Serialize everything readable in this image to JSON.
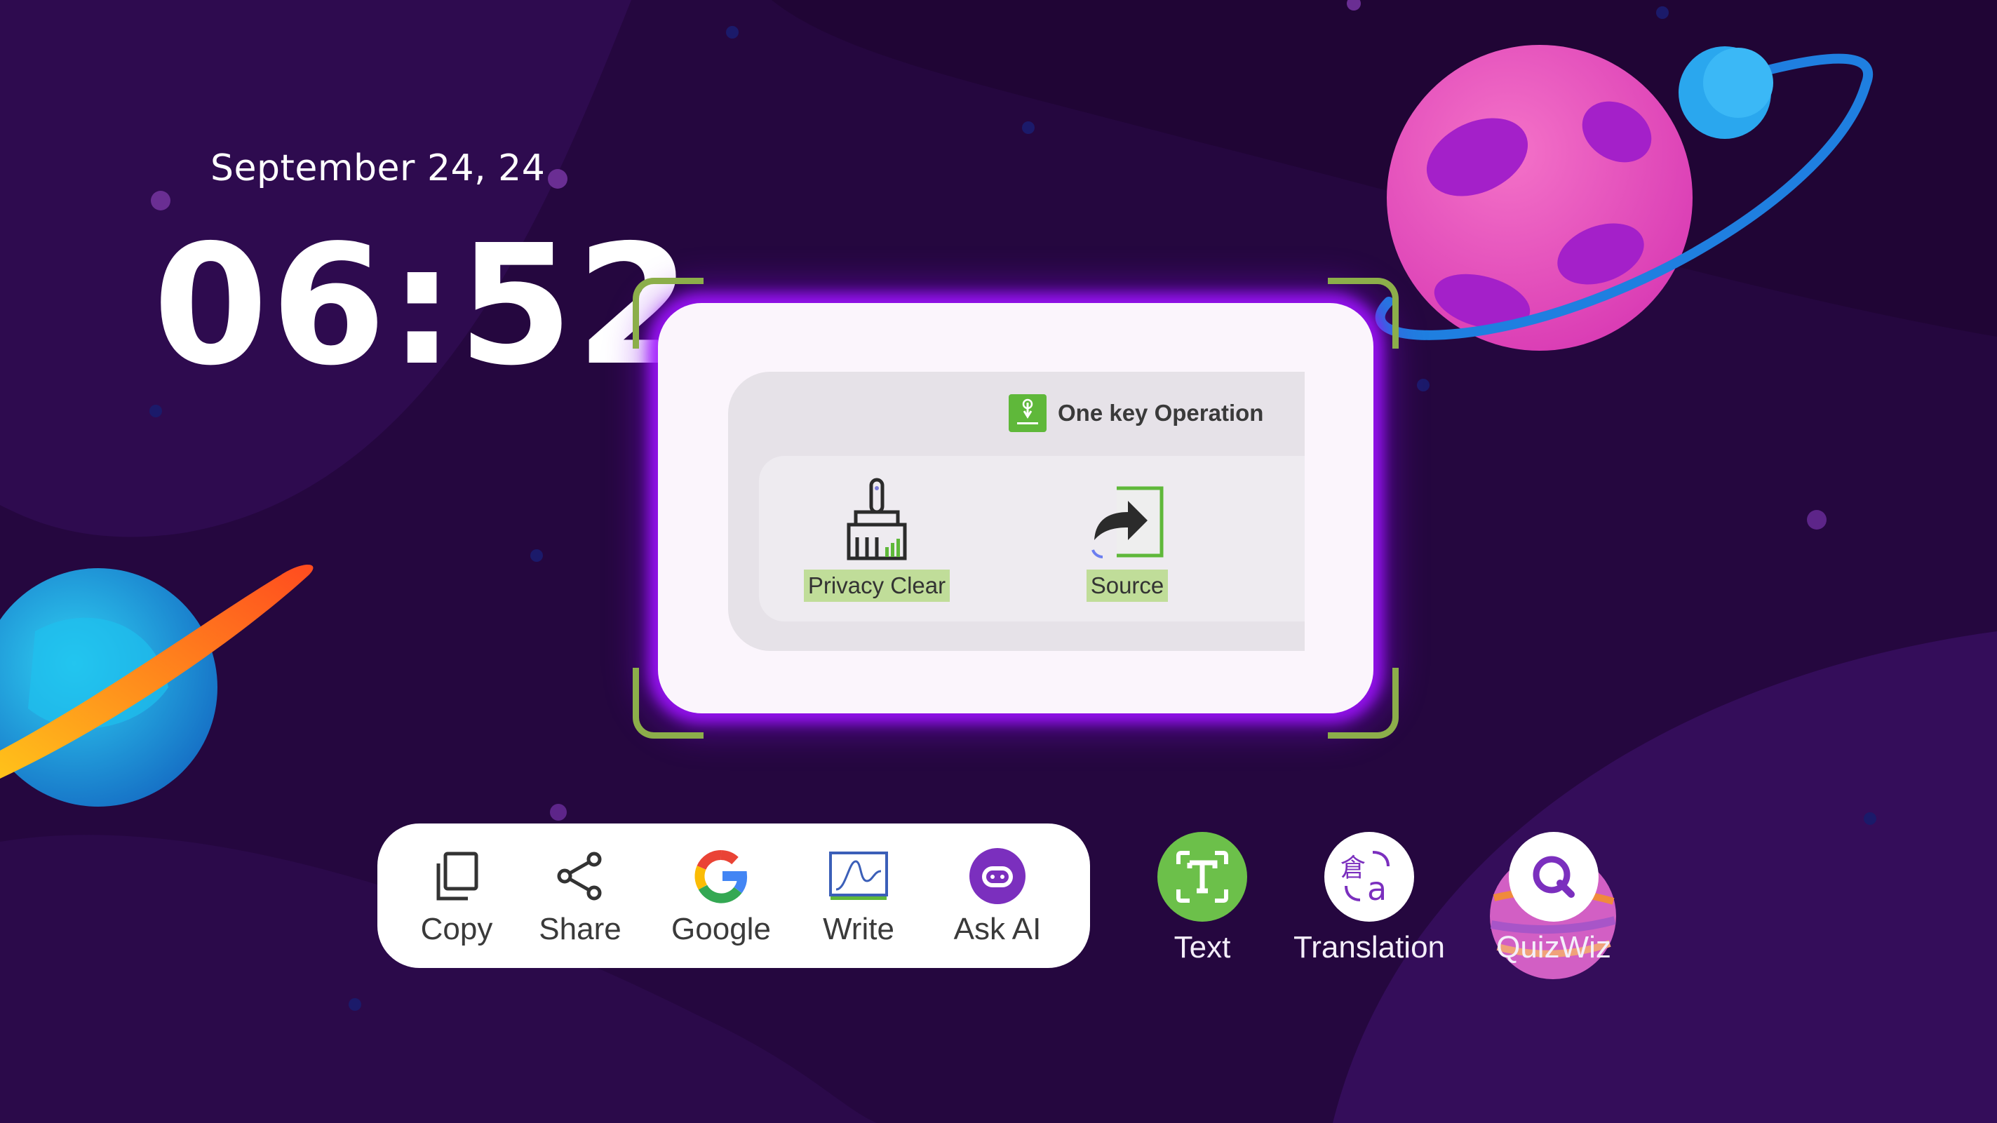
{
  "clock": {
    "date": "September 24, 24",
    "time": "06:52"
  },
  "capture_preview": {
    "title": "One key Operation",
    "items": [
      {
        "label": "Privacy Clear",
        "icon": "broom-icon"
      },
      {
        "label": "Source",
        "icon": "source-arrow-icon"
      }
    ]
  },
  "toolbar": {
    "items": [
      {
        "label": "Copy",
        "icon": "copy-icon"
      },
      {
        "label": "Share",
        "icon": "share-icon"
      },
      {
        "label": "Google",
        "icon": "google-icon"
      },
      {
        "label": "Write",
        "icon": "write-icon"
      },
      {
        "label": "Ask AI",
        "icon": "robot-icon"
      }
    ]
  },
  "quick_actions": [
    {
      "label": "Text",
      "icon": "text-scan-icon"
    },
    {
      "label": "Translation",
      "icon": "translate-icon"
    },
    {
      "label": "QuizWiz",
      "icon": "quizwiz-search-icon"
    }
  ],
  "colors": {
    "background": "#25073f",
    "accent_purple": "#7b2fbe",
    "accent_green": "#8cae4a",
    "text_button": "#6cc04a"
  }
}
